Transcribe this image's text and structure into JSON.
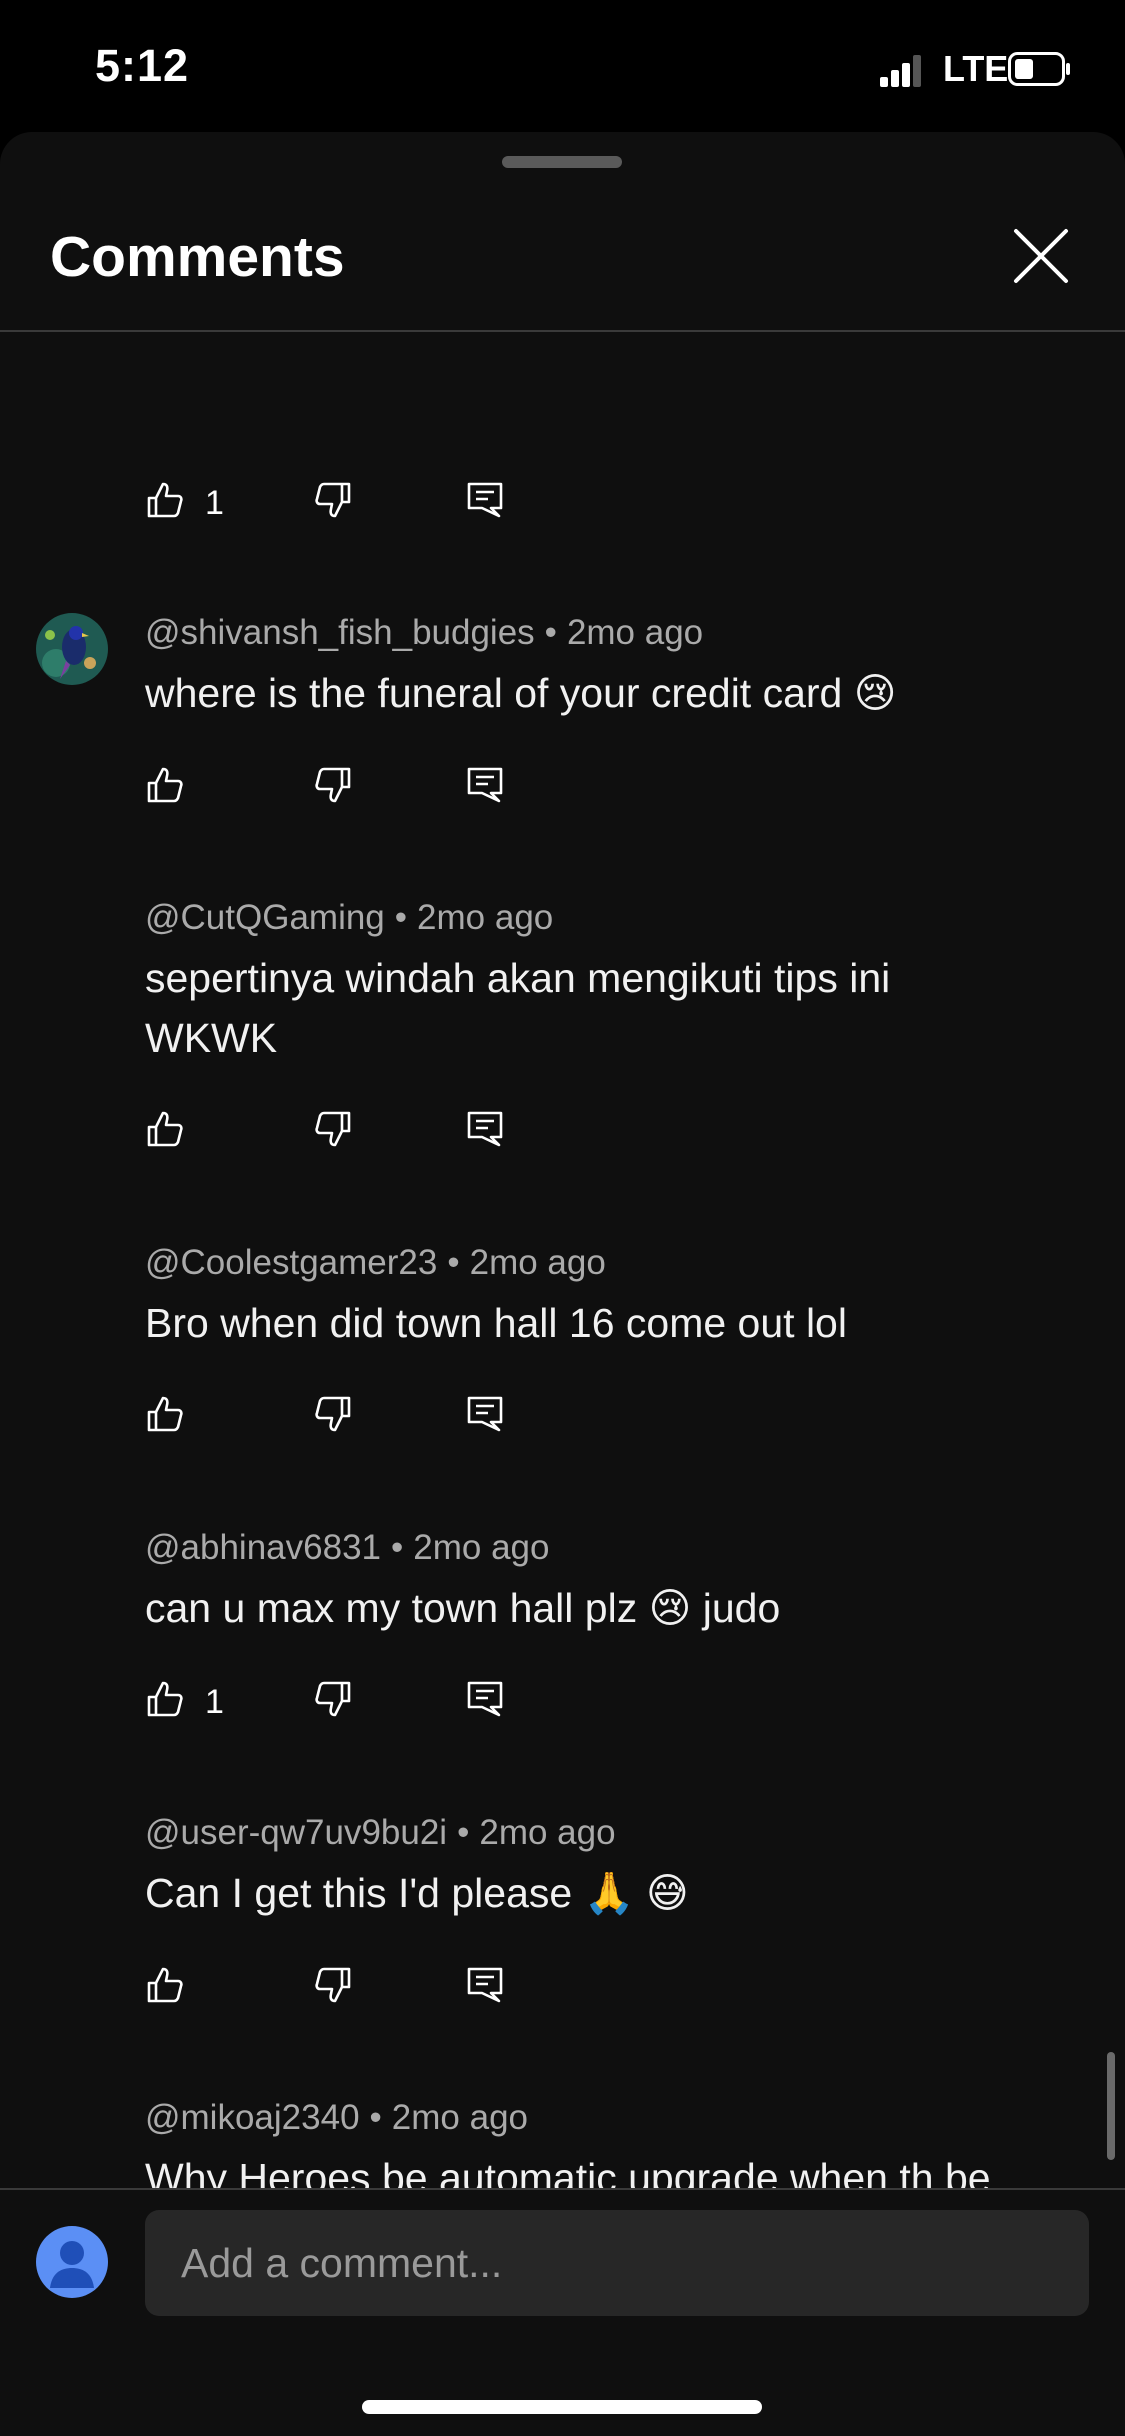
{
  "status": {
    "time": "5:12",
    "network": "LTE",
    "battery_icon": "battery-low-icon"
  },
  "header": {
    "title": "Comments",
    "close_icon": "close-icon"
  },
  "first_actions": {
    "likes": "1"
  },
  "comments": [
    {
      "author": "@shivansh_fish_budgies",
      "time": "2mo ago",
      "text": "where is the funeral of your credit card 😢",
      "likes": ""
    },
    {
      "author": "@CutQGaming",
      "time": "2mo ago",
      "text": "sepertinya windah akan mengikuti tips ini WKWK",
      "likes": ""
    },
    {
      "author": "@Coolestgamer23",
      "time": "2mo ago",
      "text": "Bro when did town hall 16 come out lol",
      "likes": ""
    },
    {
      "author": "@abhinav6831",
      "time": "2mo ago",
      "text": "can u max my town hall plz 😢 judo",
      "likes": "1"
    },
    {
      "author": "@user-qw7uv9bu2i",
      "time": "2mo ago",
      "text": "Can I get this I'd please 🙏 😅",
      "likes": ""
    },
    {
      "author": "@mikoaj2340",
      "time": "2mo ago",
      "text": "Why Heroes be automatic upgrade when th be upgrade ?",
      "likes": ""
    }
  ],
  "composer": {
    "placeholder": "Add a comment..."
  },
  "colors": {
    "sheet_bg": "#0f0f0f",
    "meta_text": "#aaaaaa",
    "input_bg": "#272727",
    "avatar_blue": "#5b8ff5"
  }
}
